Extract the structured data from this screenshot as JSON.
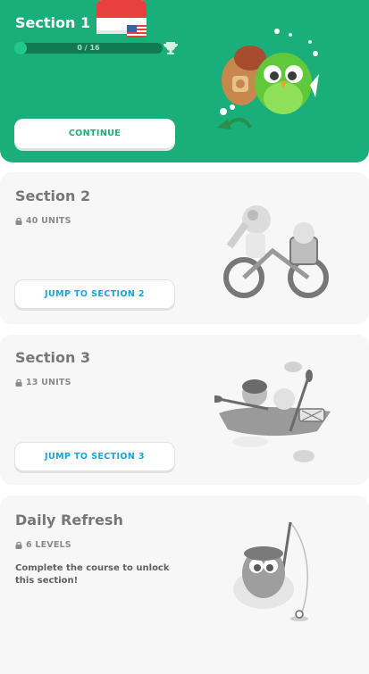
{
  "sections": [
    {
      "title": "Section 1",
      "progress": {
        "label": "0 / 16",
        "value": 0,
        "total": 16
      },
      "button_label": "CONTINUE"
    },
    {
      "title": "Section 2",
      "meta": "40 UNITS",
      "button_label": "JUMP TO SECTION 2"
    },
    {
      "title": "Section 3",
      "meta": "13 UNITS",
      "button_label": "JUMP TO SECTION 3"
    },
    {
      "title": "Daily Refresh",
      "meta": "6 LEVELS",
      "description": "Complete the course to unlock this section!"
    }
  ],
  "colors": {
    "active_bg": "#1aaf7a",
    "locked_bg": "#f7f7f7",
    "jump_text": "#1ca3d8",
    "continue_text": "#1aaf7a"
  },
  "icons": [
    "indonesia-flag-icon",
    "us-flag-icon",
    "trophy-icon",
    "lock-icon"
  ]
}
